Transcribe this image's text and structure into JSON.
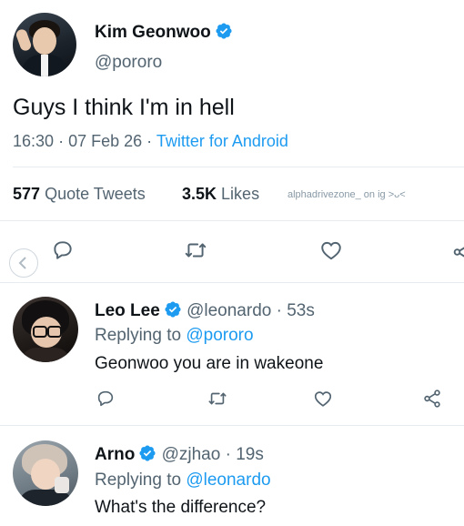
{
  "main_tweet": {
    "author_name": "Kim Geonwoo",
    "author_handle": "@pororo",
    "text": "Guys I think I'm in hell",
    "time": "16:30",
    "sep1": "·",
    "date": "07 Feb 26",
    "sep2": "·",
    "source": "Twitter for Android",
    "quote_count": "577",
    "quote_label": "Quote Tweets",
    "like_count": "3.5K",
    "like_label": "Likes",
    "watermark": "alphadrivezone_ on ig >ᴗ<"
  },
  "replies": [
    {
      "name": "Leo Lee",
      "handle": "@leonardo",
      "sep": "·",
      "time": "53s",
      "replying_label": "Replying to",
      "replying_to": "@pororo",
      "text": "Geonwoo you are in wakeone"
    },
    {
      "name": "Arno",
      "handle": "@zjhao",
      "sep": "·",
      "time": "19s",
      "replying_label": "Replying to",
      "replying_to": "@leonardo",
      "text": "What's the difference?"
    }
  ],
  "colors": {
    "accent": "#1d9bf0",
    "muted": "#536471",
    "text": "#0f1419"
  }
}
